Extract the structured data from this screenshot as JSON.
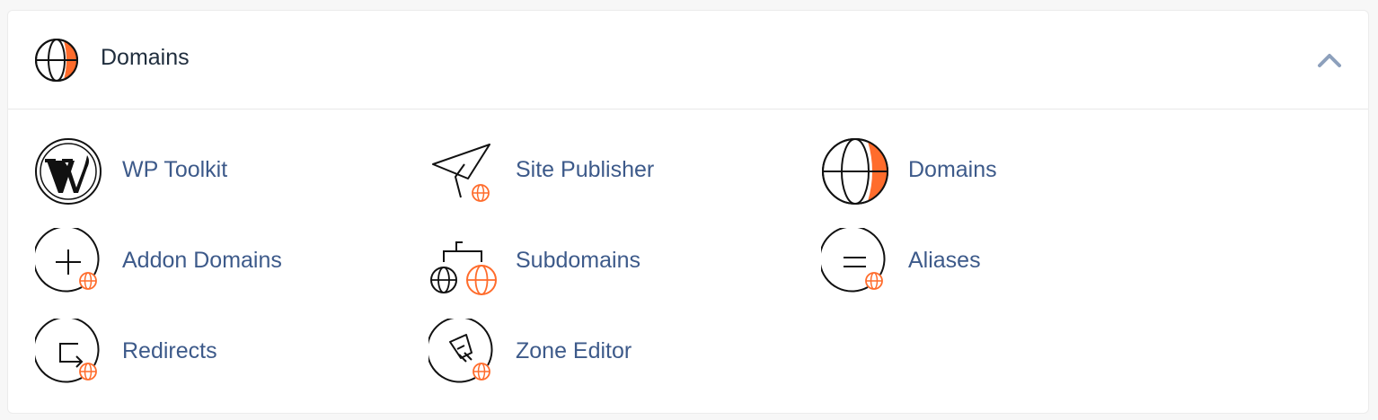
{
  "header": {
    "title": "Domains",
    "icon": "globe-icon",
    "collapse_icon": "chevron-up-icon"
  },
  "colors": {
    "accent": "#ff6c2c",
    "link": "#3d5a8a",
    "title": "#1f2d3d",
    "chevron": "#8da0bc"
  },
  "items": [
    {
      "label": "WP Toolkit",
      "icon": "wordpress-icon"
    },
    {
      "label": "Site Publisher",
      "icon": "paper-plane-icon"
    },
    {
      "label": "Domains",
      "icon": "globe-icon"
    },
    {
      "label": "Addon Domains",
      "icon": "add-domain-icon"
    },
    {
      "label": "Subdomains",
      "icon": "subdomains-icon"
    },
    {
      "label": "Aliases",
      "icon": "aliases-icon"
    },
    {
      "label": "Redirects",
      "icon": "redirect-icon"
    },
    {
      "label": "Zone Editor",
      "icon": "zone-editor-icon"
    }
  ]
}
